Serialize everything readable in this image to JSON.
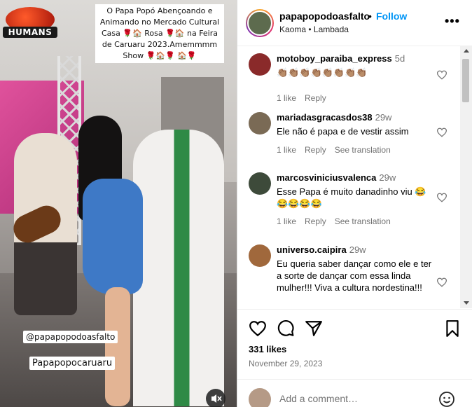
{
  "media": {
    "logo_text": "HUMANS",
    "caption": "O Papa Popó Abençoando e Animando no Mercado Cultural Casa 🌹🏠 Rosa 🌹🏠 na Feira de Caruaru 2023.Amemmmm Show 🌹🏠🌹 🏠🌹",
    "tag_handle": "@papapopodoasfalto",
    "tag_name": "Papapopocaruaru"
  },
  "header": {
    "username": "papapopodoasfalto",
    "separator": "•",
    "follow_label": "Follow",
    "audio": "Kaoma • Lambada",
    "more_label": "•••"
  },
  "comments": [
    {
      "user": "motoboy_paraiba_express",
      "time": "5d",
      "text": "👏🏽👏🏽👏🏽👏🏽👏🏽👏🏽👏🏽👏🏽",
      "likes": "1 like",
      "reply": "Reply",
      "translate": "",
      "avatar_color": "#8a2a2a"
    },
    {
      "user": "mariadasgracasdos38",
      "time": "29w",
      "text": "Ele não é papa e de vestir assim",
      "likes": "1 like",
      "reply": "Reply",
      "translate": "See translation",
      "avatar_color": "#7a6a55"
    },
    {
      "user": "marcosviniciusvalenca",
      "time": "29w",
      "text": "Esse Papa é muito danadinho viu 😂😂😂😂😂",
      "likes": "1 like",
      "reply": "Reply",
      "translate": "See translation",
      "avatar_color": "#3d4a3a"
    },
    {
      "user": "universo.caipira",
      "time": "29w",
      "text": "Eu queria saber dançar como ele e ter a sorte de dançar com essa linda mulher!!! Viva a cultura nordestina!!!",
      "likes": "",
      "reply": "",
      "translate": "",
      "avatar_color": "#a0683c"
    }
  ],
  "actions": {
    "likes": "331 likes",
    "date": "November 29, 2023"
  },
  "add_comment": {
    "placeholder": "Add a comment…"
  }
}
